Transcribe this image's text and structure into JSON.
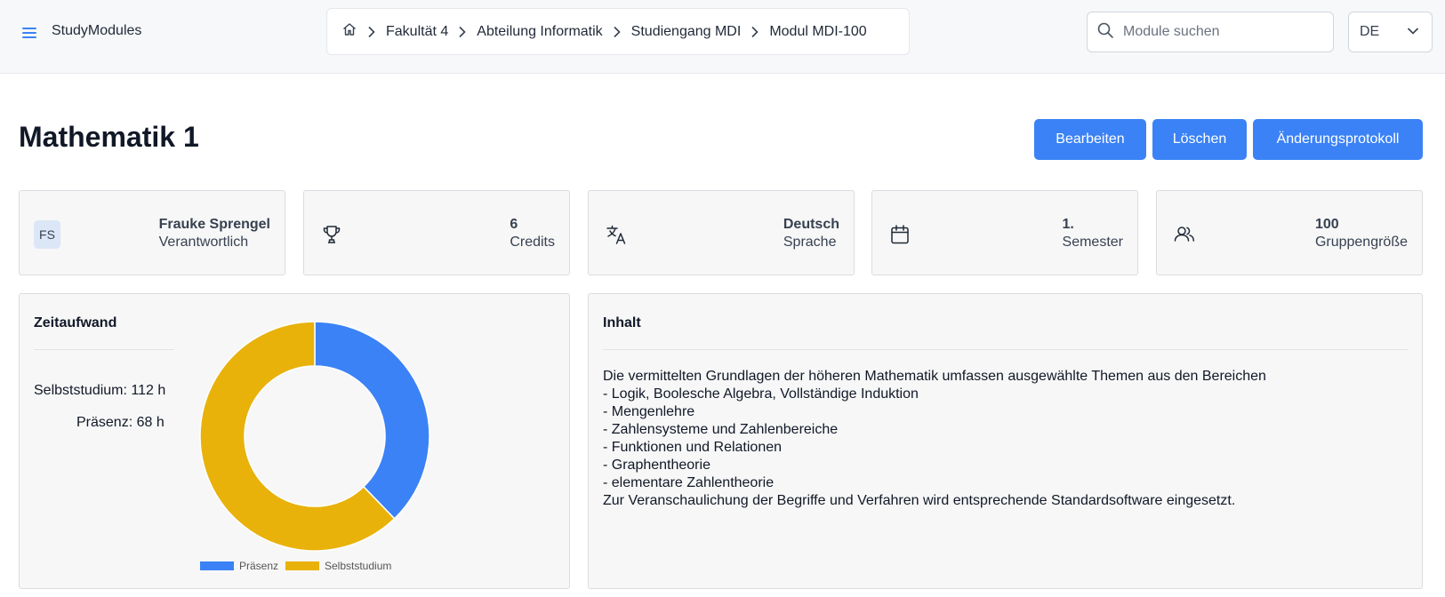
{
  "app": {
    "name": "StudyModules",
    "menu_icon": "hamburger-menu-icon"
  },
  "breadcrumb": {
    "home_icon": "home-icon",
    "items": [
      {
        "label": "Fakultät 4"
      },
      {
        "label": "Abteilung Informatik"
      },
      {
        "label": "Studiengang MDI"
      },
      {
        "label": "Modul MDI-100"
      }
    ]
  },
  "search": {
    "placeholder": "Module suchen",
    "icon": "search-icon"
  },
  "language": {
    "selected": "DE"
  },
  "page": {
    "title": "Mathematik 1"
  },
  "actions": {
    "edit": "Bearbeiten",
    "delete": "Löschen",
    "changelog": "Änderungsprotokoll"
  },
  "colors": {
    "accent": "#3b82f6",
    "presence": "#3b82f6",
    "self_study": "#e8b20b"
  },
  "stats": {
    "responsible": {
      "initials": "FS",
      "value": "Frauke Sprengel",
      "label": "Verantwortlich"
    },
    "credits": {
      "value": "6",
      "label": "Credits",
      "icon": "trophy-icon"
    },
    "language": {
      "value": "Deutsch",
      "label": "Sprache",
      "icon": "translate-icon"
    },
    "semester": {
      "value": "1.",
      "label": "Semester",
      "icon": "calendar-icon"
    },
    "group": {
      "value": "100",
      "label": "Gruppengröße",
      "icon": "users-icon"
    }
  },
  "workload": {
    "title": "Zeitaufwand",
    "self_study_label": "Selbststudium:",
    "self_study_value": "112 h",
    "presence_label": "Präsenz:",
    "presence_value": "68 h"
  },
  "chart_data": {
    "type": "pie",
    "categories": [
      "Präsenz",
      "Selbststudium"
    ],
    "values": [
      68,
      112
    ],
    "colors": [
      "#3b82f6",
      "#e8b20b"
    ],
    "legend": "bottom"
  },
  "content": {
    "title": "Inhalt",
    "lines": [
      "Die vermittelten Grundlagen der höheren Mathematik umfassen ausgewählte Themen aus den Bereichen",
      "- Logik, Boolesche Algebra, Vollständige Induktion",
      "- Mengenlehre",
      "- Zahlensysteme und Zahlenbereiche",
      "- Funktionen und Relationen",
      "- Graphentheorie",
      "- elementare Zahlentheorie",
      "Zur Veranschaulichung der Begriffe und Verfahren wird entsprechende Standardsoftware eingesetzt."
    ]
  }
}
